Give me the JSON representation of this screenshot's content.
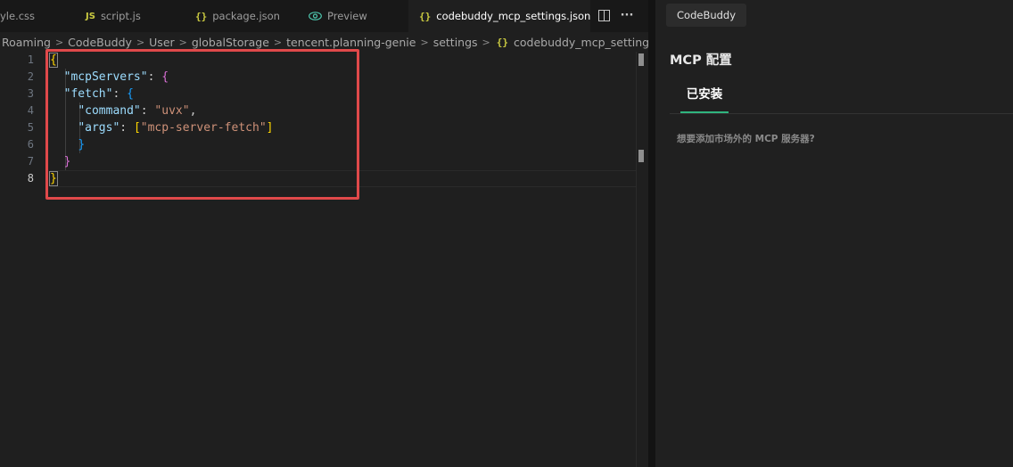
{
  "tabs": [
    {
      "label": "yle.css",
      "icon": "css-file-icon"
    },
    {
      "label": "script.js",
      "icon": "js-file-icon",
      "badge": "JS"
    },
    {
      "label": "package.json",
      "icon": "json-file-icon",
      "badge": "{}"
    },
    {
      "label": "Preview",
      "icon": "preview-eye-icon"
    },
    {
      "label": "codebuddy_mcp_settings.json",
      "icon": "json-file-icon",
      "badge": "{}",
      "active": true,
      "dirty": true
    }
  ],
  "tab_actions": {
    "split": "split-editor-icon",
    "more": "more-actions-icon",
    "more_glyph": "···"
  },
  "breadcrumb": [
    "Roaming",
    "CodeBuddy",
    "User",
    "globalStorage",
    "tencent.planning-genie",
    "settings",
    "codebuddy_mcp_settings.json",
    "..."
  ],
  "breadcrumb_file_badge": "{}",
  "editor": {
    "line_numbers": [
      "1",
      "2",
      "3",
      "4",
      "5",
      "6",
      "7",
      "8"
    ],
    "current_line": "8",
    "code_lines": [
      "{",
      "  \"mcpServers\": {",
      "  \"fetch\": {",
      "    \"command\": \"uvx\",",
      "    \"args\": [\"mcp-server-fetch\"]",
      "    }",
      "  }",
      "}"
    ],
    "highlight_color": "#e0494a"
  },
  "panel": {
    "tab_label": "CodeBuddy",
    "title": "MCP 配置",
    "subtab": "已安装",
    "hint": "想要添加市场外的 MCP 服务器?",
    "accent_color": "#2fb57f"
  }
}
